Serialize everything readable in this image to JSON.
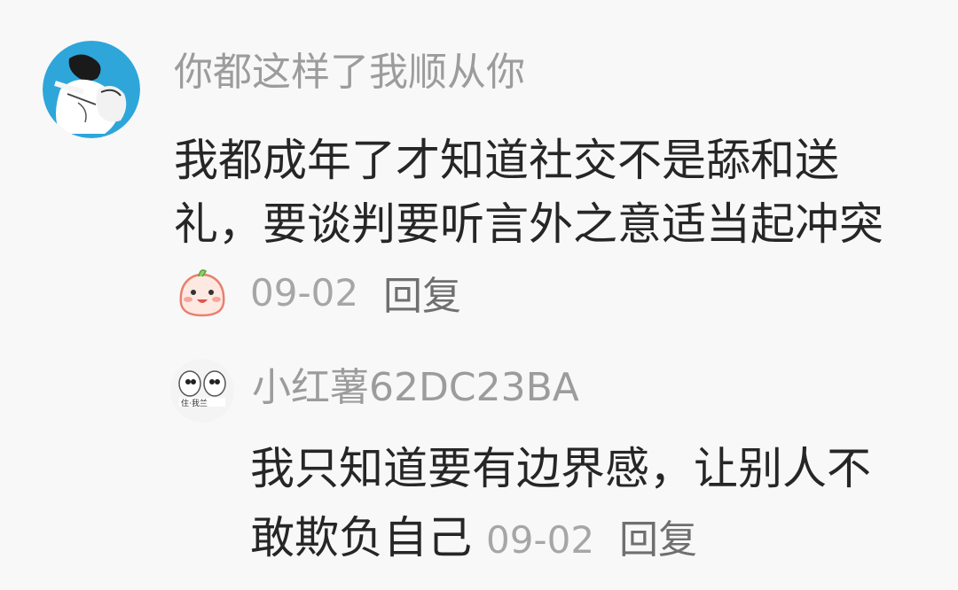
{
  "main_comment": {
    "username": "你都这样了我顺从你",
    "text_lines": [
      "我都成年了才知道社交不是舔和送",
      "礼，要谈判要听言外之意适当起冲突"
    ],
    "reaction_icon": "cute-face-emoji-icon",
    "date": "09-02",
    "reply_label": "回复",
    "avatar_icon": "anime-avatar-icon"
  },
  "reply_comment": {
    "username": "小红薯62DC23BA",
    "text_lines": [
      "我只知道要有边界感，让别人不",
      "敢欺负自己"
    ],
    "date": "09-02",
    "reply_label": "回复",
    "avatar_icon": "meme-avatar-icon"
  },
  "colors": {
    "background": "#f8f8f8",
    "username": "#9c9c9c",
    "body_text": "#262626",
    "date": "#a6a6a6",
    "reply": "#6f6f6f",
    "avatar_bg": "#2aa7dc"
  }
}
